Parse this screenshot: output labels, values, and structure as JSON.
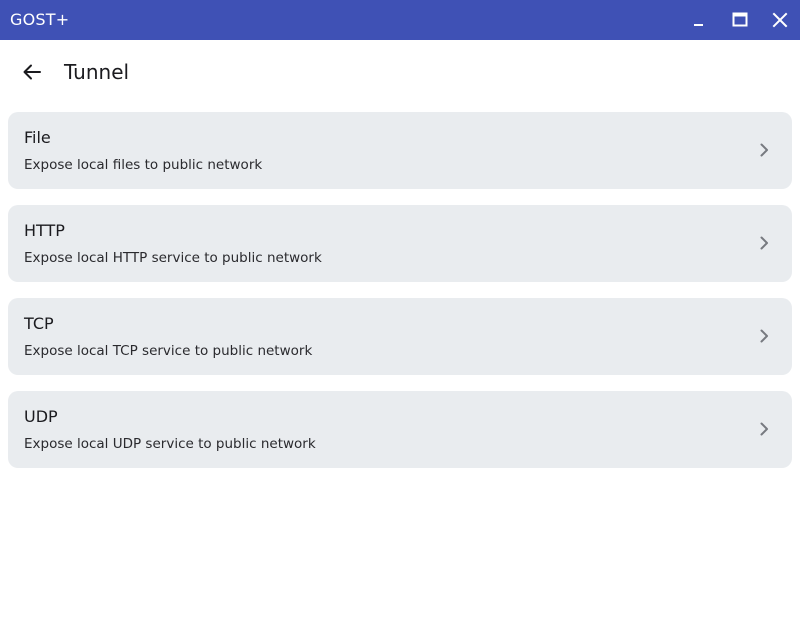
{
  "window": {
    "title": "GOST+",
    "colors": {
      "titlebar": "#3f51b5",
      "card": "#e9ecef"
    },
    "controls": [
      "minimize-icon",
      "maximize-icon",
      "close-icon"
    ]
  },
  "header": {
    "back_icon": "arrow-left-icon",
    "title": "Tunnel"
  },
  "items": [
    {
      "title": "File",
      "subtitle": "Expose local files to public network",
      "icon": "chevron-right-icon"
    },
    {
      "title": "HTTP",
      "subtitle": "Expose local HTTP service to public network",
      "icon": "chevron-right-icon"
    },
    {
      "title": "TCP",
      "subtitle": "Expose local TCP service to public network",
      "icon": "chevron-right-icon"
    },
    {
      "title": "UDP",
      "subtitle": "Expose local UDP service to public network",
      "icon": "chevron-right-icon"
    }
  ]
}
